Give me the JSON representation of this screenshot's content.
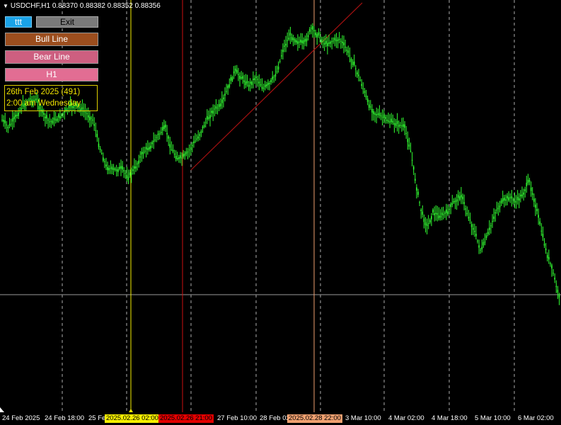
{
  "header": {
    "symbol": "USDCHF,H1",
    "ohlc": "0.88370 0.88382 0.88352 0.88356"
  },
  "buttons": {
    "ttt": "ttt",
    "exit": "Exit",
    "bull_line": "Bull Line",
    "bear_line": "Bear Line",
    "timeframe": "H1"
  },
  "info": {
    "line1": "26th Feb 2025 (491)",
    "line2": "2:00 am Wednesday"
  },
  "x_axis": {
    "labels": [
      "24 Feb 2025",
      "24 Feb 18:00",
      "25 Feb",
      "27 Feb 10:00",
      "28 Feb 02",
      "3 Mar 10:00",
      "4 Mar 02:00",
      "4 Mar 18:00",
      "5 Mar 10:00",
      "6 Mar 02:00"
    ],
    "tag_yellow": "2025.02.26 02:00",
    "tag_red": "2025.02.26 21:00",
    "tag_orange": "2025.02.28 22:00"
  },
  "colors": {
    "background": "#000000",
    "candles": "#32ff32",
    "yellow_line": "#f6ef00",
    "red_line": "#cc1111",
    "orange_line": "#f0a070",
    "trend_line": "#aa1111",
    "grid": "#d8d8d8"
  }
}
